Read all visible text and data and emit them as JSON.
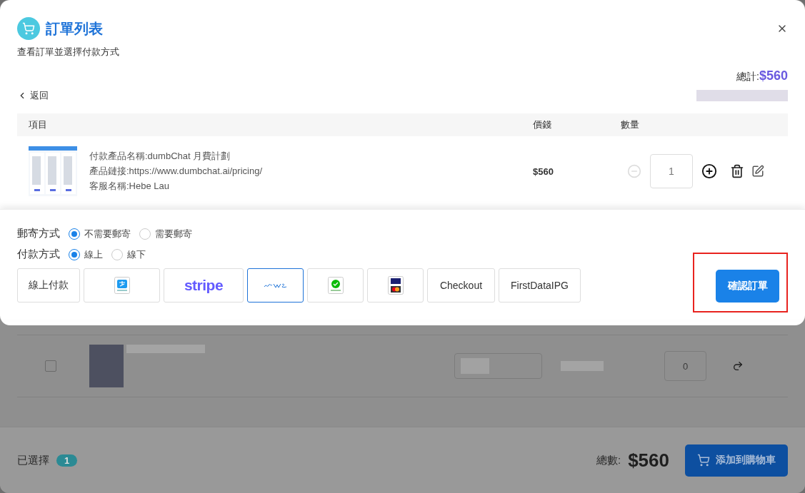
{
  "modal": {
    "title": "訂單列表",
    "subtitle": "查看訂單並選擇付款方式",
    "total_label": "總計:",
    "total_value": "$560",
    "back": "返回"
  },
  "table": {
    "columns": [
      "項目",
      "價錢",
      "數量"
    ],
    "rows": [
      {
        "lines": [
          "付款產品名稱:dumbChat 月費計劃",
          "產品鏈接:https://www.dumbchat.ai/pricing/",
          "客服名稱:Hebe Lau"
        ],
        "price": "$560",
        "quantity": "1",
        "decrease_disabled": true
      }
    ]
  },
  "shipping": {
    "label": "郵寄方式",
    "options": [
      {
        "label": "不需要郵寄",
        "selected": true
      },
      {
        "label": "需要郵寄",
        "selected": false
      }
    ]
  },
  "payment": {
    "label": "付款方式",
    "options": [
      {
        "label": "線上",
        "selected": true
      },
      {
        "label": "線下",
        "selected": false
      }
    ],
    "methods": [
      {
        "kind": "text",
        "label": "線上付款",
        "selected": false
      },
      {
        "kind": "square",
        "selected": false
      },
      {
        "kind": "wordmark",
        "label": "stripe",
        "selected": false
      },
      {
        "kind": "script",
        "selected": true
      },
      {
        "kind": "bubble",
        "selected": false
      },
      {
        "kind": "cards",
        "selected": false
      },
      {
        "kind": "text",
        "label": "Checkout",
        "selected": false
      },
      {
        "kind": "text",
        "label": "FirstDataIPG",
        "selected": false
      }
    ]
  },
  "confirm": {
    "label": "確認訂單",
    "highlighted": true
  },
  "background": {
    "row": {
      "checked": false,
      "quantity": "0"
    },
    "footer": {
      "selected_label": "已選擇",
      "selected_count": "1",
      "total_label": "總數:",
      "total_value": "$560",
      "button": "添加到購物車"
    }
  }
}
